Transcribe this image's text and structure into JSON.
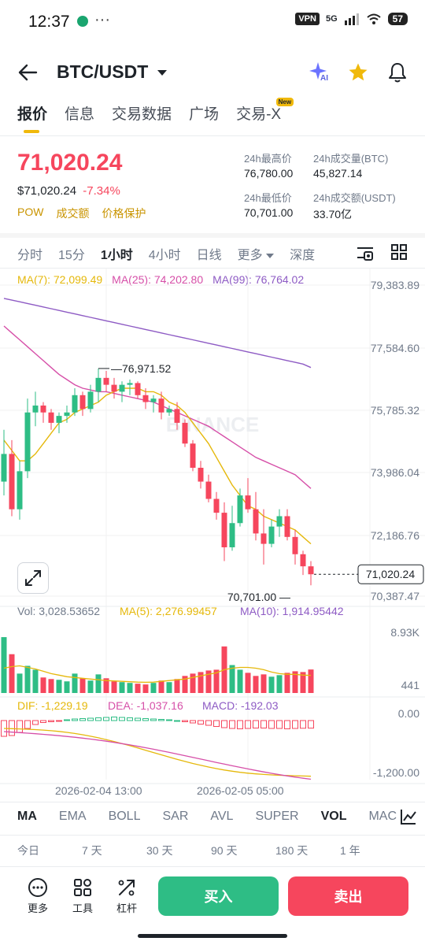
{
  "status_bar": {
    "time": "12:37",
    "vpn": "VPN",
    "network": "5G",
    "battery": "57"
  },
  "header": {
    "pair": "BTC/USDT",
    "ai_label": "AI"
  },
  "tabs": [
    {
      "label": "报价",
      "active": true
    },
    {
      "label": "信息",
      "active": false
    },
    {
      "label": "交易数据",
      "active": false
    },
    {
      "label": "广场",
      "active": false
    },
    {
      "label": "交易-X",
      "active": false,
      "badge": "New"
    }
  ],
  "price": {
    "last": "71,020.24",
    "usd": "$71,020.24",
    "change": "-7.34%",
    "tags": [
      "POW",
      "成交额",
      "价格保护"
    ]
  },
  "stats": {
    "high_label": "24h最高价",
    "high": "76,780.00",
    "vol_btc_label": "24h成交量(BTC)",
    "vol_btc": "45,827.14",
    "low_label": "24h最低价",
    "low": "70,701.00",
    "vol_usdt_label": "24h成交额(USDT)",
    "vol_usdt": "33.70亿"
  },
  "intervals": [
    {
      "label": "分时",
      "active": false
    },
    {
      "label": "15分",
      "active": false
    },
    {
      "label": "1小时",
      "active": true
    },
    {
      "label": "4小时",
      "active": false
    },
    {
      "label": "日线",
      "active": false
    },
    {
      "label": "更多",
      "active": false
    },
    {
      "label": "深度",
      "active": false
    }
  ],
  "ma_legend": {
    "ma7": "MA(7): 72,099.49",
    "ma25": "MA(25): 74,202.80",
    "ma99": "MA(99): 76,764.02"
  },
  "price_axis": [
    "79,383.89",
    "77,584.60",
    "75,785.32",
    "73,986.04",
    "72,186.76",
    "70,387.47"
  ],
  "chart_labels": {
    "high_marker": "76,971.52",
    "low_marker": "70,701.00",
    "current_price": "71,020.24",
    "watermark": "BINANCE"
  },
  "vol_legend": {
    "vol": "Vol: 3,028.53652",
    "ma5": "MA(5): 2,276.99457",
    "ma10": "MA(10): 1,914.95442",
    "axis_top": "8.93K",
    "axis_bottom": "441"
  },
  "macd_legend": {
    "dif": "DIF: -1,229.19",
    "dea": "DEA: -1,037.16",
    "macd": "MACD: -192.03",
    "axis_top": "0.00",
    "axis_bottom": "-1,200.00"
  },
  "time_axis": [
    "2026-02-04 13:00",
    "2026-02-05 05:00"
  ],
  "indicators": [
    {
      "label": "MA",
      "active": true
    },
    {
      "label": "EMA",
      "active": false
    },
    {
      "label": "BOLL",
      "active": false
    },
    {
      "label": "SAR",
      "active": false
    },
    {
      "label": "AVL",
      "active": false
    },
    {
      "label": "SUPER",
      "active": false
    },
    {
      "label": "VOL",
      "active": true
    },
    {
      "label": "MAC",
      "active": false
    }
  ],
  "performance": [
    "今日",
    "7 天",
    "30 天",
    "90 天",
    "180 天",
    "1 年"
  ],
  "bottom_tools": [
    {
      "label": "更多",
      "icon": "more-icon"
    },
    {
      "label": "工具",
      "icon": "tools-icon"
    },
    {
      "label": "杠杆",
      "icon": "leverage-icon"
    }
  ],
  "actions": {
    "buy": "买入",
    "sell": "卖出"
  },
  "colors": {
    "up": "#2ebd85",
    "down": "#f6465d",
    "accent": "#f0b90b",
    "ma7": "#e5b80b",
    "ma25": "#d64fa8",
    "ma99": "#8e5bc4"
  },
  "chart_data": {
    "type": "candlestick",
    "interval": "1小时",
    "y_range": [
      70387.47,
      79383.89
    ],
    "candles": [
      {
        "o": 73700,
        "h": 75200,
        "l": 73300,
        "c": 74500
      },
      {
        "o": 74500,
        "h": 74900,
        "l": 72700,
        "c": 72900
      },
      {
        "o": 72900,
        "h": 74300,
        "l": 72600,
        "c": 74000
      },
      {
        "o": 74000,
        "h": 76100,
        "l": 73800,
        "c": 75700
      },
      {
        "o": 75700,
        "h": 76300,
        "l": 75300,
        "c": 75900
      },
      {
        "o": 75900,
        "h": 76000,
        "l": 75400,
        "c": 75700
      },
      {
        "o": 75700,
        "h": 75800,
        "l": 75200,
        "c": 75400
      },
      {
        "o": 75400,
        "h": 75700,
        "l": 75100,
        "c": 75600
      },
      {
        "o": 75600,
        "h": 75900,
        "l": 75400,
        "c": 75700
      },
      {
        "o": 75700,
        "h": 76400,
        "l": 75600,
        "c": 76200
      },
      {
        "o": 76200,
        "h": 76300,
        "l": 75600,
        "c": 75800
      },
      {
        "o": 75800,
        "h": 76500,
        "l": 75700,
        "c": 76300
      },
      {
        "o": 76300,
        "h": 76970,
        "l": 76000,
        "c": 76700
      },
      {
        "o": 76700,
        "h": 76900,
        "l": 76300,
        "c": 76500
      },
      {
        "o": 76500,
        "h": 76700,
        "l": 76100,
        "c": 76300
      },
      {
        "o": 76300,
        "h": 76600,
        "l": 76000,
        "c": 76500
      },
      {
        "o": 76500,
        "h": 76650,
        "l": 76200,
        "c": 76550
      },
      {
        "o": 76550,
        "h": 76600,
        "l": 76100,
        "c": 76200
      },
      {
        "o": 76200,
        "h": 76400,
        "l": 75800,
        "c": 76000
      },
      {
        "o": 76000,
        "h": 76200,
        "l": 75700,
        "c": 76100
      },
      {
        "o": 76100,
        "h": 76300,
        "l": 75500,
        "c": 75700
      },
      {
        "o": 75700,
        "h": 75900,
        "l": 75600,
        "c": 75800
      },
      {
        "o": 75800,
        "h": 76000,
        "l": 75200,
        "c": 75400
      },
      {
        "o": 75400,
        "h": 75500,
        "l": 74700,
        "c": 74800
      },
      {
        "o": 74800,
        "h": 74900,
        "l": 74000,
        "c": 74100
      },
      {
        "o": 74100,
        "h": 74300,
        "l": 73500,
        "c": 73700
      },
      {
        "o": 73700,
        "h": 73900,
        "l": 73100,
        "c": 73200
      },
      {
        "o": 73200,
        "h": 73400,
        "l": 72600,
        "c": 72800
      },
      {
        "o": 72800,
        "h": 73100,
        "l": 71400,
        "c": 71800
      },
      {
        "o": 71800,
        "h": 73000,
        "l": 71700,
        "c": 72500
      },
      {
        "o": 72500,
        "h": 73500,
        "l": 72400,
        "c": 73300
      },
      {
        "o": 73300,
        "h": 73800,
        "l": 72800,
        "c": 72900
      },
      {
        "o": 72900,
        "h": 73400,
        "l": 72000,
        "c": 72200
      },
      {
        "o": 72200,
        "h": 72900,
        "l": 71300,
        "c": 71900
      },
      {
        "o": 71900,
        "h": 72600,
        "l": 71800,
        "c": 72400
      },
      {
        "o": 72400,
        "h": 72900,
        "l": 72100,
        "c": 72700
      },
      {
        "o": 72700,
        "h": 72900,
        "l": 72000,
        "c": 72100
      },
      {
        "o": 72100,
        "h": 72300,
        "l": 71300,
        "c": 71600
      },
      {
        "o": 71600,
        "h": 71700,
        "l": 71000,
        "c": 71250
      },
      {
        "o": 71250,
        "h": 71400,
        "l": 70701,
        "c": 71020
      }
    ],
    "ma7": [
      74900,
      74600,
      74300,
      74300,
      74500,
      74800,
      75100,
      75400,
      75500,
      75700,
      75800,
      75900,
      76000,
      76200,
      76300,
      76400,
      76400,
      76400,
      76300,
      76300,
      76200,
      76000,
      75900,
      75700,
      75400,
      75100,
      74800,
      74400,
      74000,
      73600,
      73300,
      73000,
      72900,
      72700,
      72600,
      72500,
      72400,
      72300,
      72100,
      71900
    ],
    "ma25": [
      78200,
      78000,
      77800,
      77600,
      77400,
      77200,
      77000,
      76800,
      76650,
      76500,
      76400,
      76350,
      76300,
      76300,
      76250,
      76200,
      76150,
      76100,
      76050,
      76000,
      75900,
      75800,
      75700,
      75600,
      75500,
      75400,
      75300,
      75150,
      75000,
      74850,
      74700,
      74550,
      74400,
      74300,
      74200,
      74100,
      74000,
      73900,
      73700,
      73500
    ],
    "ma99": [
      79000,
      78950,
      78900,
      78850,
      78800,
      78750,
      78700,
      78650,
      78600,
      78550,
      78500,
      78450,
      78400,
      78350,
      78300,
      78250,
      78200,
      78150,
      78100,
      78050,
      78000,
      77950,
      77900,
      77850,
      77800,
      77750,
      77700,
      77650,
      77600,
      77550,
      77500,
      77450,
      77400,
      77350,
      77300,
      77250,
      77200,
      77150,
      77100,
      77000
    ],
    "volume": [
      7200,
      5000,
      2500,
      3500,
      3000,
      2000,
      1800,
      1700,
      1500,
      2500,
      1900,
      1600,
      2400,
      1900,
      1500,
      1400,
      1300,
      1200,
      1100,
      1300,
      1600,
      1400,
      1800,
      2200,
      2500,
      2700,
      2900,
      3000,
      6000,
      3600,
      3000,
      2600,
      2200,
      2400,
      2100,
      2300,
      2600,
      2800,
      2700,
      3028
    ],
    "vol_ma5": [
      3200,
      3400,
      3500,
      3300,
      3100,
      2800,
      2500,
      2300,
      2100,
      2000,
      1900,
      1800,
      1700,
      1600,
      1550,
      1500,
      1450,
      1400,
      1380,
      1400,
      1500,
      1600,
      1700,
      1800,
      2000,
      2200,
      2400,
      2600,
      3000,
      3200,
      3300,
      3300,
      3200,
      3000,
      2700,
      2500,
      2400,
      2400,
      2300,
      2277
    ],
    "macd_hist": [
      -400,
      -380,
      -300,
      -200,
      -100,
      -50,
      -30,
      -10,
      20,
      40,
      50,
      60,
      70,
      80,
      90,
      80,
      70,
      60,
      50,
      40,
      30,
      20,
      0,
      -30,
      -60,
      -90,
      -120,
      -150,
      -180,
      -200,
      -210,
      -200,
      -190,
      -190,
      -200,
      -200,
      -210,
      -200,
      -195,
      -192
    ]
  }
}
